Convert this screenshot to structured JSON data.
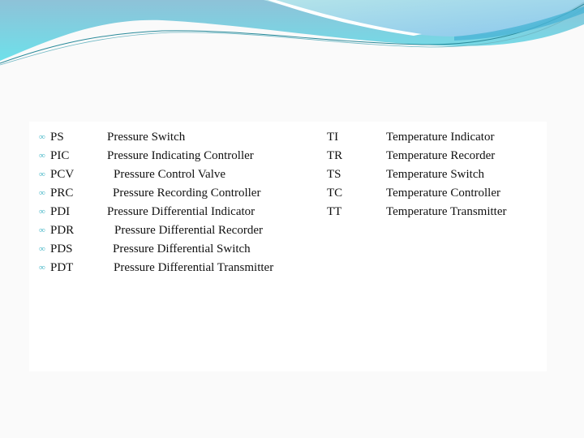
{
  "slide": {
    "pressure_items": [
      {
        "code": "PS",
        "meaning": "Pressure Switch"
      },
      {
        "code": "PIC",
        "meaning": "Pressure Indicating Controller"
      },
      {
        "code": "PCV",
        "meaning": "Pressure Control Valve"
      },
      {
        "code": "PRC",
        "meaning": "Pressure Recording Controller"
      },
      {
        "code": "PDI",
        "meaning": "Pressure Differential Indicator"
      },
      {
        "code": "PDR",
        "meaning": "Pressure Differential Recorder"
      },
      {
        "code": "PDS",
        "meaning": "Pressure Differential Switch"
      },
      {
        "code": "PDT",
        "meaning": "Pressure Differential Transmitter"
      }
    ],
    "temperature_items": [
      {
        "code": "TI",
        "meaning": "Temperature Indicator"
      },
      {
        "code": "TR",
        "meaning": "Temperature Recorder"
      },
      {
        "code": "TS",
        "meaning": "Temperature Switch"
      },
      {
        "code": "TC",
        "meaning": "Temperature Controller"
      },
      {
        "code": "TT",
        "meaning": "Temperature Transmitter"
      }
    ],
    "bullet_icon": "loop-bullet-icon",
    "colors": {
      "bullet": "#4ab8c8",
      "wave_primary": "#7cc4dc",
      "wave_accent": "#62d6e6",
      "wave_line": "#2a8a9a"
    }
  }
}
